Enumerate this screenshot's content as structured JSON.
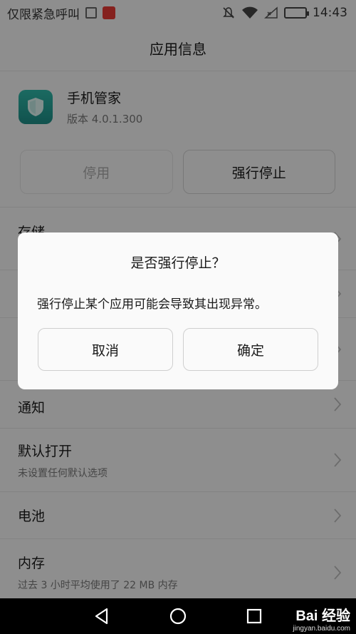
{
  "status_bar": {
    "carrier_text": "仅限紧急呼叫",
    "time": "14:43",
    "icons": [
      "image-icon",
      "weibo-icon",
      "mute-icon",
      "wifi-icon",
      "signal-icon",
      "battery-icon"
    ]
  },
  "app_bar": {
    "title": "应用信息"
  },
  "app": {
    "name": "手机管家",
    "version": "版本 4.0.1.300",
    "icon": "shield-icon",
    "icon_color": "#26a69a"
  },
  "buttons": {
    "disable_label": "停用",
    "force_stop_label": "强行停止"
  },
  "list": {
    "storage": {
      "title": "存储"
    },
    "notifications": {
      "title": "通知"
    },
    "default_open": {
      "title": "默认打开",
      "subtitle": "未设置任何默认选项"
    },
    "battery": {
      "title": "电池"
    },
    "memory": {
      "title": "内存",
      "subtitle": "过去 3 小时平均使用了 22 MB 内存"
    }
  },
  "dialog": {
    "title": "是否强行停止？",
    "message": "强行停止某个应用可能会导致其出现异常。",
    "cancel_label": "取消",
    "confirm_label": "确定"
  },
  "watermark": {
    "main": "Bai 经验",
    "sub": "jingyan.baidu.com"
  }
}
